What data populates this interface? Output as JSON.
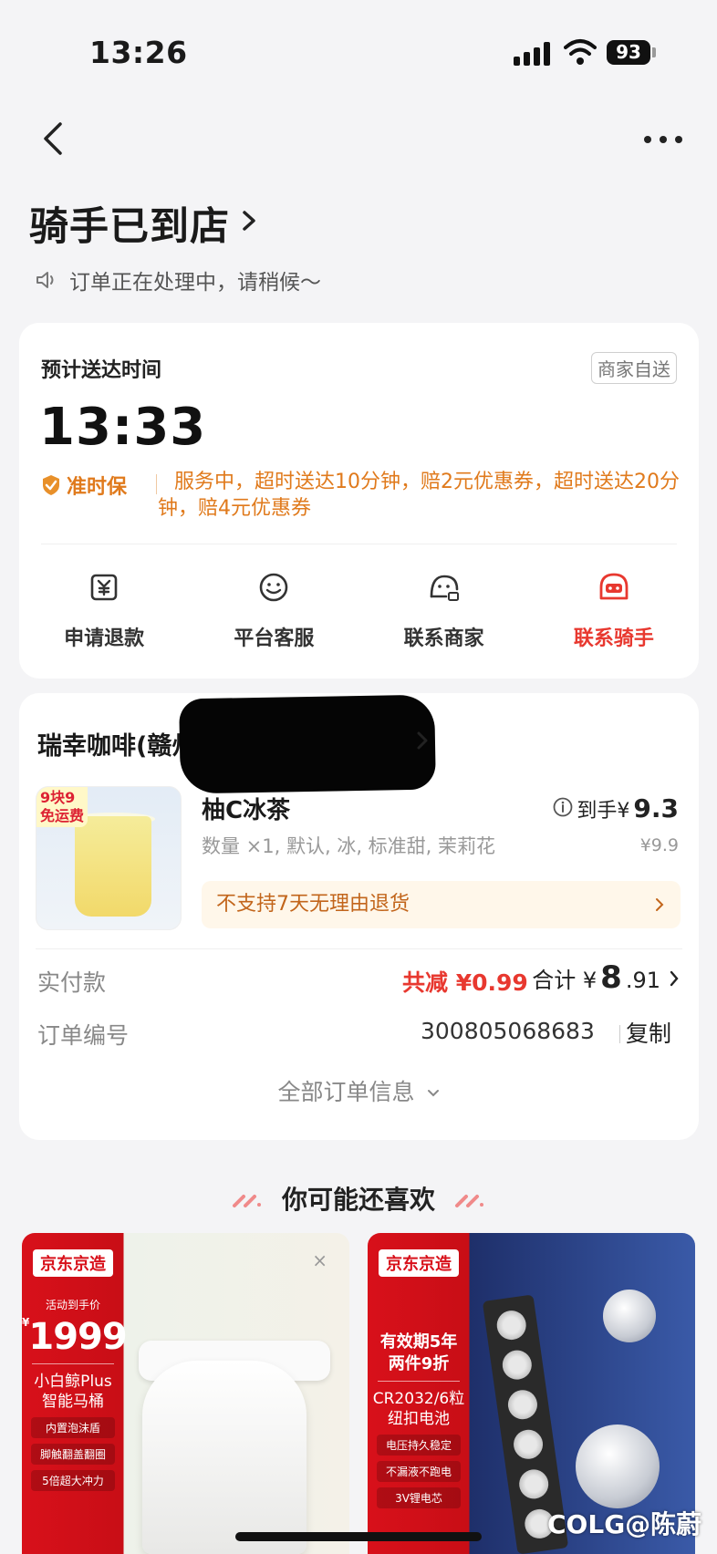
{
  "status_bar": {
    "time": "13:26",
    "battery": "93"
  },
  "header": {
    "status_title": "骑手已到店",
    "status_sub": "订单正在处理中，请稍候～"
  },
  "eta_card": {
    "label": "预计送达时间",
    "badge": "商家自送",
    "time": "13:33",
    "ontime_label": "准时保",
    "ontime_text": "服务中，超时送达10分钟，赔2元优惠券，超时送达20分钟，赔4元优惠券",
    "actions": [
      {
        "label": "申请退款",
        "icon": "refund-icon"
      },
      {
        "label": "平台客服",
        "icon": "customer-service-icon"
      },
      {
        "label": "联系商家",
        "icon": "merchant-icon"
      },
      {
        "label": "联系骑手",
        "icon": "rider-icon"
      }
    ]
  },
  "order_card": {
    "store_name": "瑞幸咖啡(赣州南",
    "promo_tag_line1": "9块9",
    "promo_tag_line2": "免运费",
    "product_name": "柚C冰茶",
    "final_price_prefix": "到手¥",
    "final_price": "9.3",
    "spec": "数量 ×1, 默认, 冰, 标准甜, 茉莉花",
    "original_price": "¥9.9",
    "no_return": "不支持7天无理由退货",
    "paid_label": "实付款",
    "discount": "共减 ¥0.99",
    "total_prefix": "合计 ¥",
    "total_big": "8",
    "total_small": ".91",
    "order_no_label": "订单编号",
    "order_no": "300805068683",
    "copy": "复制",
    "all_info": "全部订单信息"
  },
  "recommend": {
    "title": "你可能还喜欢",
    "items": [
      {
        "brand": "京东京造",
        "small": "活动到手价",
        "price_symbol": "¥",
        "price": "1999",
        "name_line1": "小白鲸Plus",
        "name_line2": "智能马桶",
        "features": [
          "内置泡沫盾",
          "脚触翻盖翻圈",
          "5倍超大冲力"
        ]
      },
      {
        "brand": "京东京造",
        "headline_line1": "有效期5年",
        "headline_line2": "两件9折",
        "name_line1": "CR2032/6粒",
        "name_line2": "纽扣电池",
        "features": [
          "电压持久稳定",
          "不漏液不跑电",
          "3V锂电芯"
        ]
      }
    ]
  },
  "watermark": "COLG@陈蔚",
  "colors": {
    "accent_red": "#e8382f",
    "orange": "#e07a1c",
    "jd_red": "#d8101a"
  }
}
